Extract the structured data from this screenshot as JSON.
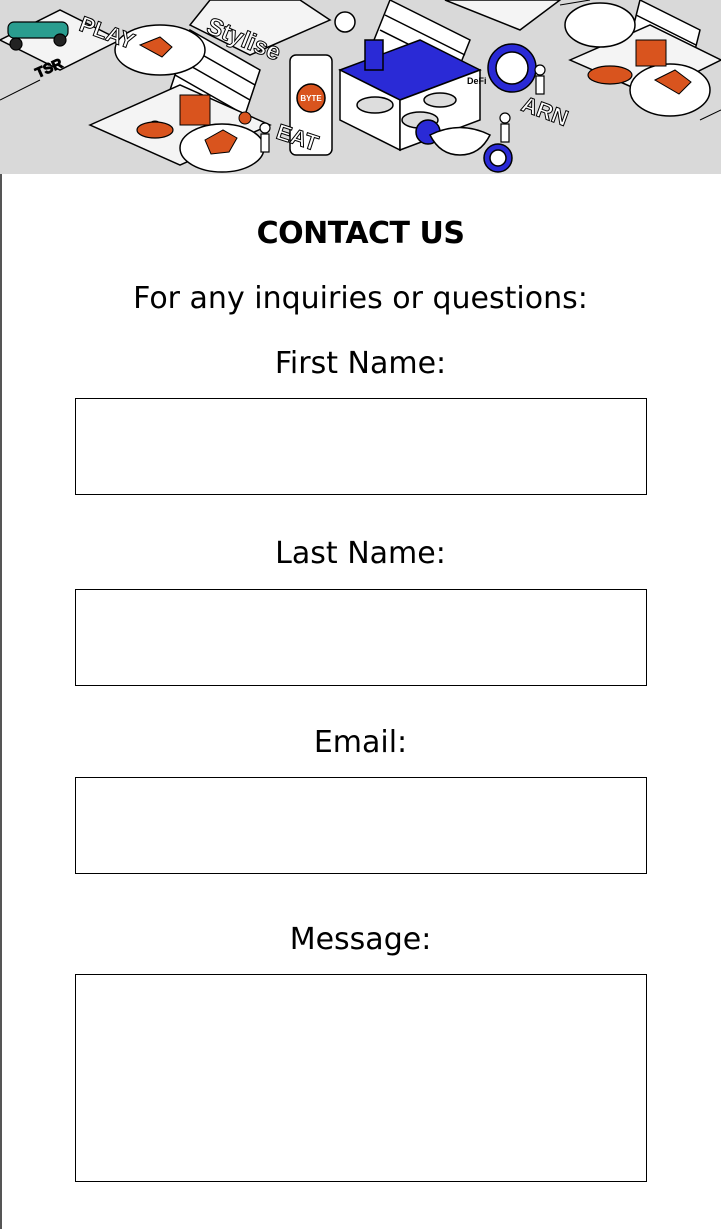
{
  "header": {
    "image_name": "isometric-city-illustration",
    "sign_texts": [
      "PLAY",
      "Stylise",
      "EAT",
      "BYTE",
      "ARN",
      "TSR",
      "DeFi"
    ]
  },
  "contact": {
    "title": "CONTACT US",
    "subtitle": "For any inquiries or questions:"
  },
  "form": {
    "first_name": {
      "label": "First Name:",
      "value": ""
    },
    "last_name": {
      "label": "Last Name:",
      "value": ""
    },
    "email": {
      "label": "Email:",
      "value": ""
    },
    "message": {
      "label": "Message:",
      "value": ""
    }
  },
  "colors": {
    "accent_orange": "#d9541e",
    "accent_blue": "#2a2ad6",
    "teal": "#2a9d8f",
    "illustration_bg": "#d9d9d9"
  }
}
